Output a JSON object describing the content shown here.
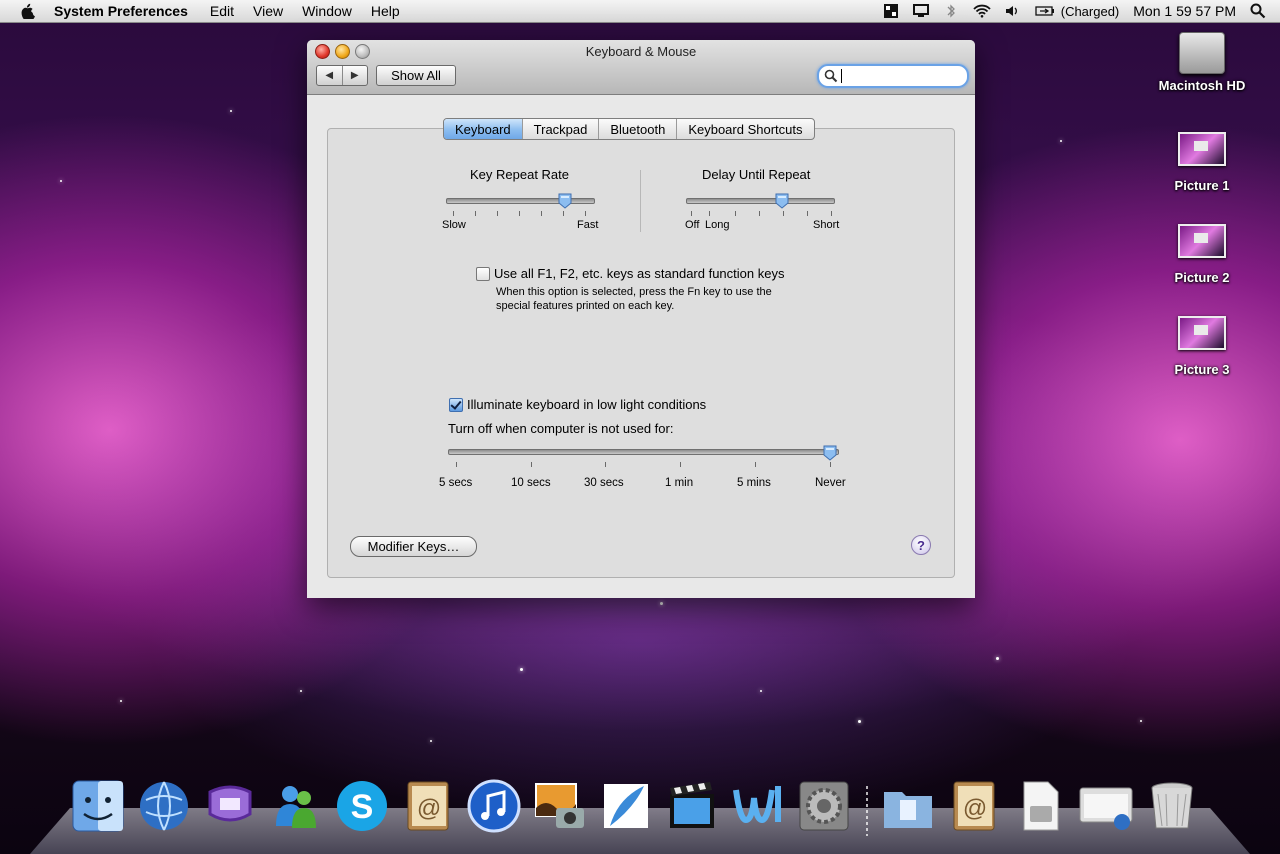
{
  "menubar": {
    "app_name": "System Preferences",
    "menus": [
      "Edit",
      "View",
      "Window",
      "Help"
    ],
    "battery_status": "(Charged)",
    "clock": "Mon 1 59 57 PM"
  },
  "window": {
    "title": "Keyboard & Mouse",
    "show_all_label": "Show All",
    "search_value": "",
    "back_glyph": "◀",
    "forward_glyph": "▶"
  },
  "tabs": [
    {
      "label": "Keyboard",
      "active": true
    },
    {
      "label": "Trackpad",
      "active": false
    },
    {
      "label": "Bluetooth",
      "active": false
    },
    {
      "label": "Keyboard Shortcuts",
      "active": false
    }
  ],
  "key_repeat": {
    "title": "Key Repeat Rate",
    "min_label": "Slow",
    "max_label": "Fast",
    "value_fraction": 0.8
  },
  "delay_repeat": {
    "title": "Delay Until Repeat",
    "off_label": "Off",
    "min_label": "Long",
    "max_label": "Short",
    "value_fraction": 0.65
  },
  "function_keys": {
    "label": "Use all F1, F2, etc. keys as standard function keys",
    "checked": false,
    "help_line1": "When this option is selected, press the Fn key to use the",
    "help_line2": "special features printed on each key."
  },
  "illuminate": {
    "label": "Illuminate keyboard in low light conditions",
    "checked": true,
    "turn_off_label": "Turn off when computer is not used for:",
    "ticks": [
      "5 secs",
      "10 secs",
      "30 secs",
      "1 min",
      "5 mins",
      "Never"
    ],
    "selected": "Never"
  },
  "buttons": {
    "modifier_keys": "Modifier Keys…",
    "help": "?"
  },
  "desktop_icons": [
    {
      "label": "Macintosh HD"
    },
    {
      "label": "Picture 1"
    },
    {
      "label": "Picture 2"
    },
    {
      "label": "Picture 3"
    }
  ],
  "dock_items": [
    "finder-icon",
    "network-globe-icon",
    "messenger-icon",
    "msn-icon",
    "skype-icon",
    "address-book-icon",
    "itunes-icon",
    "iphoto-icon",
    "photoshop-feather-icon",
    "imovie-icon",
    "word-icon",
    "system-preferences-icon",
    "documents-folder-icon",
    "address-book-stack-icon",
    "preview-icon",
    "network-utility-icon",
    "trash-icon"
  ],
  "colors": {
    "accent_blue": "#6fa8e8",
    "close": "#e0372b",
    "minimize": "#f0a81a"
  }
}
